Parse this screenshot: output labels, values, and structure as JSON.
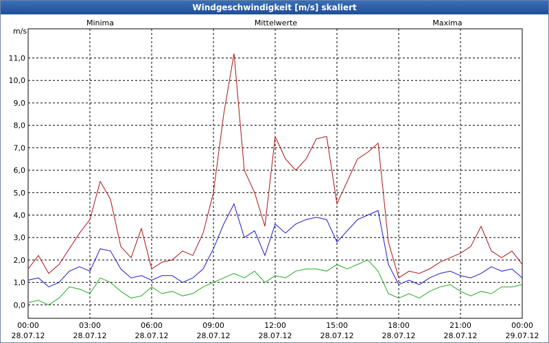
{
  "window": {
    "title": "Windgeschwindigkeit [m/s] skaliert"
  },
  "chart_data": {
    "type": "line",
    "title": "Windgeschwindigkeit [m/s] skaliert",
    "ylabel": "m/s",
    "xlabel": "",
    "ylim": [
      -0.6,
      12.3
    ],
    "xlim": [
      0,
      24
    ],
    "grid": true,
    "legend": "top",
    "y_ticks": [
      "0,0",
      "1,0",
      "2,0",
      "3,0",
      "4,0",
      "5,0",
      "6,0",
      "7,0",
      "8,0",
      "9,0",
      "10,0",
      "11,0"
    ],
    "x_ticks": [
      {
        "time": "00:00",
        "date": "28.07.12"
      },
      {
        "time": "03:00",
        "date": "28.07.12"
      },
      {
        "time": "06:00",
        "date": "28.07.12"
      },
      {
        "time": "09:00",
        "date": "28.07.12"
      },
      {
        "time": "12:00",
        "date": "28.07.12"
      },
      {
        "time": "15:00",
        "date": "28.07.12"
      },
      {
        "time": "18:00",
        "date": "28.07.12"
      },
      {
        "time": "21:00",
        "date": "28.07.12"
      },
      {
        "time": "00:00",
        "date": "29.07.12"
      }
    ],
    "x_hours": [
      0,
      0.5,
      1,
      1.5,
      2,
      2.5,
      3,
      3.5,
      4,
      4.5,
      5,
      5.5,
      6,
      6.5,
      7,
      7.5,
      8,
      8.5,
      9,
      9.5,
      10,
      10.5,
      11,
      11.5,
      12,
      12.5,
      13,
      13.5,
      14,
      14.5,
      15,
      15.5,
      16,
      16.5,
      17,
      17.5,
      18,
      18.5,
      19,
      19.5,
      20,
      20.5,
      21,
      21.5,
      22,
      22.5,
      23,
      23.5,
      24
    ],
    "colors": {
      "Minima": "#22aa22",
      "Mittelwerte": "#1a1acc",
      "Maxima": "#aa1111"
    },
    "series": [
      {
        "name": "Minima",
        "values": [
          0.1,
          0.2,
          0.0,
          0.3,
          0.8,
          0.7,
          0.5,
          1.2,
          1.0,
          0.6,
          0.3,
          0.4,
          0.8,
          0.5,
          0.6,
          0.4,
          0.5,
          0.8,
          1.0,
          1.2,
          1.4,
          1.2,
          1.5,
          1.0,
          1.3,
          1.2,
          1.5,
          1.6,
          1.6,
          1.5,
          1.8,
          1.6,
          1.8,
          2.0,
          1.5,
          0.5,
          0.3,
          0.5,
          0.3,
          0.6,
          0.8,
          0.9,
          0.6,
          0.4,
          0.6,
          0.5,
          0.8,
          0.8,
          0.9
        ]
      },
      {
        "name": "Mittelwerte",
        "values": [
          1.1,
          1.2,
          0.8,
          1.0,
          1.5,
          1.7,
          1.5,
          2.5,
          2.4,
          1.6,
          1.2,
          1.3,
          1.1,
          1.3,
          1.3,
          1.0,
          1.2,
          1.6,
          2.5,
          3.6,
          4.5,
          3.0,
          3.3,
          2.2,
          3.6,
          3.2,
          3.6,
          3.8,
          3.9,
          3.8,
          2.8,
          3.3,
          3.8,
          4.0,
          4.2,
          1.8,
          0.9,
          1.1,
          0.9,
          1.2,
          1.4,
          1.5,
          1.3,
          1.2,
          1.4,
          1.7,
          1.5,
          1.6,
          1.2
        ]
      },
      {
        "name": "Maxima",
        "values": [
          1.6,
          2.2,
          1.4,
          1.8,
          2.5,
          3.2,
          3.8,
          5.5,
          4.7,
          2.6,
          2.1,
          3.4,
          1.6,
          1.9,
          2.0,
          2.4,
          2.2,
          3.2,
          5.0,
          8.5,
          11.2,
          6.0,
          5.0,
          3.5,
          7.5,
          6.5,
          6.0,
          6.5,
          7.4,
          7.5,
          4.5,
          5.5,
          6.5,
          6.8,
          7.2,
          2.8,
          1.2,
          1.5,
          1.4,
          1.6,
          1.9,
          2.1,
          2.3,
          2.6,
          3.5,
          2.4,
          2.1,
          2.4,
          1.8
        ]
      }
    ]
  }
}
